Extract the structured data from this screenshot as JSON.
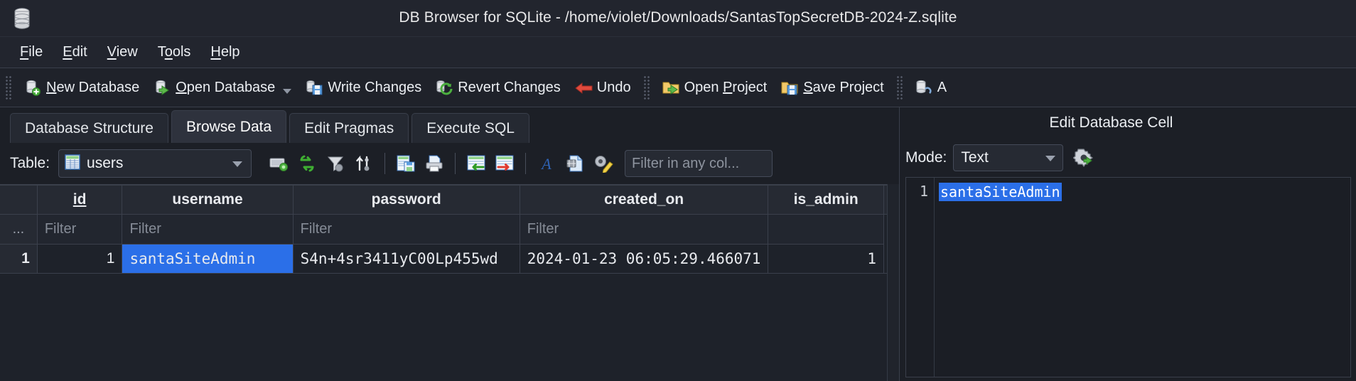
{
  "window": {
    "title": "DB Browser for SQLite - /home/violet/Downloads/SantasTopSecretDB-2024-Z.sqlite",
    "app_icon": "database-icon"
  },
  "menubar": {
    "items": [
      {
        "label": "File",
        "accel": "F"
      },
      {
        "label": "Edit",
        "accel": "E"
      },
      {
        "label": "View",
        "accel": "V"
      },
      {
        "label": "Tools",
        "accel": "o"
      },
      {
        "label": "Help",
        "accel": "H"
      }
    ]
  },
  "toolbar": {
    "buttons": [
      {
        "label": "New Database",
        "icon": "new-database-icon",
        "has_caret": false
      },
      {
        "label": "Open Database",
        "icon": "open-database-icon",
        "has_caret": true
      },
      {
        "label": "Write Changes",
        "icon": "write-changes-icon",
        "has_caret": false
      },
      {
        "label": "Revert Changes",
        "icon": "revert-changes-icon",
        "has_caret": false
      },
      {
        "label": "Undo",
        "icon": "undo-icon",
        "has_caret": false
      },
      {
        "label": "Open Project",
        "icon": "open-project-icon",
        "has_caret": false
      },
      {
        "label": "Save Project",
        "icon": "save-project-icon",
        "has_caret": false
      },
      {
        "label": "A",
        "icon": "attach-database-icon",
        "has_caret": false
      }
    ]
  },
  "tabs": [
    {
      "label": "Database Structure",
      "active": false
    },
    {
      "label": "Browse Data",
      "active": true
    },
    {
      "label": "Edit Pragmas",
      "active": false
    },
    {
      "label": "Execute SQL",
      "active": false
    }
  ],
  "browse_toolbar": {
    "table_label": "Table:",
    "selected_table": "users",
    "table_icon": "table-grid-icon",
    "icons": [
      "new-record-icon",
      "refresh-icon",
      "filter-icon",
      "sort-icon",
      "save-results-icon",
      "print-icon",
      "insert-column-left-icon",
      "delete-column-icon",
      "font-icon",
      "export-csv-icon",
      "edit-display-format-icon"
    ],
    "filter_placeholder": "Filter in any col..."
  },
  "grid": {
    "columns": [
      "id",
      "username",
      "password",
      "created_on",
      "is_admin"
    ],
    "filter_placeholder": "Filter",
    "filter_rowhdr": "...",
    "rows": [
      {
        "rownum": "1",
        "cells": [
          "1",
          "santaSiteAdmin",
          "S4n+4sr3411yC00Lp455wd",
          "2024-01-23 06:05:29.466071",
          "1"
        ]
      }
    ],
    "selected_cell": {
      "row": 0,
      "column": 1
    }
  },
  "edit_panel": {
    "title": "Edit Database Cell",
    "mode_label": "Mode:",
    "mode_value": "Text",
    "gear_icon": "apply-settings-icon",
    "line_number": "1",
    "value": "santaSiteAdmin"
  },
  "colors": {
    "selection_blue": "#2b6fe8",
    "window_bg": "#1c1f26",
    "panel_bg": "#22252e",
    "border": "#3a3f4b"
  }
}
